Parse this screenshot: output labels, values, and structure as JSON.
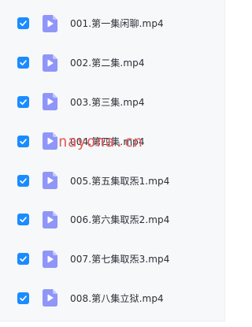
{
  "files": [
    {
      "name": "001.第一集闲聊.mp4",
      "checked": true,
      "icon": "video-file-icon"
    },
    {
      "name": "002.第二集.mp4",
      "checked": true,
      "icon": "video-file-icon"
    },
    {
      "name": "003.第三集.mp4",
      "checked": true,
      "icon": "video-file-icon"
    },
    {
      "name": "004.第四集.mp4",
      "checked": true,
      "icon": "video-file-icon"
    },
    {
      "name": "005.第五集取炁1.mp4",
      "checked": true,
      "icon": "video-file-icon"
    },
    {
      "name": "006.第六集取炁2.mp4",
      "checked": true,
      "icon": "video-file-icon"
    },
    {
      "name": "007.第七集取炁3.mp4",
      "checked": true,
      "icon": "video-file-icon"
    },
    {
      "name": "008.第八集立狱.mp4",
      "checked": true,
      "icon": "video-file-icon"
    }
  ],
  "watermark": "nayona.cn",
  "colors": {
    "checkbox": "#1a8cff",
    "icon_body": "#8f96f7",
    "icon_fold": "#c3c7fb",
    "watermark": "#e35d5d",
    "panel_bg": "#f7f8fa",
    "text": "#2b2f36"
  }
}
